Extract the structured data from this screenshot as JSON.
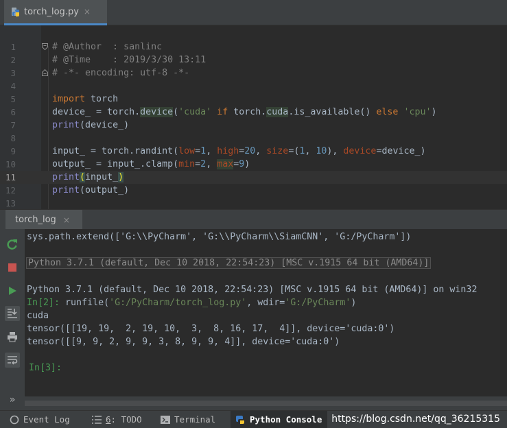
{
  "editor_tab": {
    "title": "torch_log.py",
    "close": "×"
  },
  "editor": {
    "line_numbers": [
      "1",
      "2",
      "3",
      "4",
      "5",
      "6",
      "7",
      "8",
      "9",
      "10",
      "11",
      "12",
      "13"
    ],
    "current_line": 11,
    "lines": [
      "# @Author  : sanlinc",
      "# @Time    : 2019/3/30 13:11",
      "# -*- encoding: utf-8 -*-",
      "",
      "import torch",
      "device_ = torch.device('cuda' if torch.cuda.is_available() else 'cpu')",
      "print(device_)",
      "",
      "input_ = torch.randint(low=1, high=20, size=(1, 10), device=device_)",
      "output_ = input_.clamp(min=2, max=9)",
      "print(input_)",
      "print(output_)",
      ""
    ]
  },
  "console_tab": {
    "title": "torch_log",
    "close": "×"
  },
  "console": {
    "toolbar_icons": [
      "rerun-icon",
      "stop-icon",
      "run-icon",
      "scroll-to-end-icon",
      "print-icon",
      "soft-wrap-icon",
      "expand-icon"
    ],
    "expand_label": "»",
    "lines": [
      {
        "text": "sys.path.extend(['G:\\\\PyCharm', 'G:\\\\PyCharm\\\\SiamCNN', 'G:/PyCharm'])",
        "kind": "normal"
      },
      {
        "text": "",
        "kind": "normal"
      },
      {
        "text": "Python 3.7.1 (default, Dec 10 2018, 22:54:23) [MSC v.1915 64 bit (AMD64)]",
        "kind": "boxed"
      },
      {
        "text": "",
        "kind": "normal"
      },
      {
        "text": "Python 3.7.1 (default, Dec 10 2018, 22:54:23) [MSC v.1915 64 bit (AMD64)] on win32",
        "kind": "normal"
      },
      {
        "text": "runfile('G:/PyCharm/torch_log.py', wdir='G:/PyCharm')",
        "prompt": "In[2]: ",
        "kind": "prompt"
      },
      {
        "text": "cuda",
        "kind": "normal"
      },
      {
        "text": "tensor([[19, 19,  2, 19, 10,  3,  8, 16, 17,  4]], device='cuda:0')",
        "kind": "normal"
      },
      {
        "text": "tensor([[9, 9, 2, 9, 9, 3, 8, 9, 9, 4]], device='cuda:0')",
        "kind": "normal"
      },
      {
        "text": "",
        "kind": "normal"
      },
      {
        "text": "",
        "prompt": "In[3]:",
        "kind": "prompt-empty"
      }
    ]
  },
  "status_bar": {
    "items": [
      {
        "icon": "event-log-icon",
        "label": "Event Log"
      },
      {
        "icon": "todo-icon",
        "label_number": "6",
        "label": ": TODO"
      },
      {
        "icon": "terminal-icon",
        "label": "Terminal"
      },
      {
        "icon": "python-console-icon",
        "label": "Python Console",
        "active": true
      }
    ],
    "watermark": "https://blog.csdn.net/qq_36215315"
  }
}
